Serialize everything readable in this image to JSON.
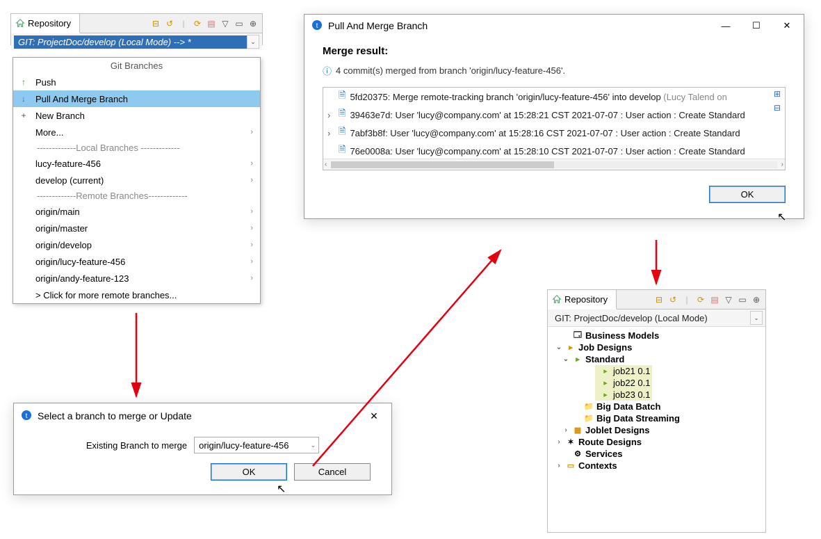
{
  "repo_left": {
    "tab_label": "Repository",
    "branch_selector": "GIT: ProjectDoc/develop   (Local Mode)   -->  *",
    "menu_title": "Git Branches",
    "push": "Push",
    "pull_merge": "Pull And Merge Branch",
    "new_branch": "New Branch",
    "more": "More...",
    "sep_local": "-------------Local   Branches -------------",
    "local": [
      "lucy-feature-456",
      "develop (current)"
    ],
    "sep_remote": "-------------Remote Branches-------------",
    "remote": [
      "origin/main",
      "origin/master",
      "origin/develop",
      "origin/lucy-feature-456",
      "origin/andy-feature-123"
    ],
    "more_remote": "> Click for more remote branches..."
  },
  "select_dialog": {
    "title": "Select a branch to merge or Update",
    "label": "Existing Branch to merge",
    "selected": "origin/lucy-feature-456",
    "ok": "OK",
    "cancel": "Cancel"
  },
  "merge_dialog": {
    "title": "Pull And Merge Branch",
    "heading": "Merge result:",
    "info": "4 commit(s) merged from branch 'origin/lucy-feature-456'.",
    "commits": [
      {
        "pre": "",
        "sha": "5fd20375",
        "msg": ": Merge remote-tracking branch 'origin/lucy-feature-456' into develop ",
        "trail": "(Lucy Talend on"
      },
      {
        "pre": "›",
        "sha": "39463e7d",
        "msg": ": User 'lucy@company.com' at 15:28:21 CST 2021-07-07 :  User action : Create Standard",
        "trail": ""
      },
      {
        "pre": "›",
        "sha": "7abf3b8f",
        "msg": ": User 'lucy@company.com' at 15:28:16 CST 2021-07-07 :  User action : Create Standard",
        "trail": ""
      },
      {
        "pre": "",
        "sha": "76e0008a",
        "msg": ": User 'lucy@company.com' at 15:28:10 CST 2021-07-07 :  User action : Create Standard",
        "trail": ""
      }
    ],
    "ok": "OK"
  },
  "repo_right": {
    "tab_label": "Repository",
    "branch_selector": "GIT: ProjectDoc/develop   (Local Mode)",
    "tree": {
      "business_models": "Business Models",
      "job_designs": "Job Designs",
      "standard": "Standard",
      "jobs": [
        "job21 0.1",
        "job22 0.1",
        "job23 0.1"
      ],
      "big_data_batch": "Big Data Batch",
      "big_data_streaming": "Big Data Streaming",
      "joblet": "Joblet Designs",
      "route": "Route Designs",
      "services": "Services",
      "contexts": "Contexts"
    }
  }
}
